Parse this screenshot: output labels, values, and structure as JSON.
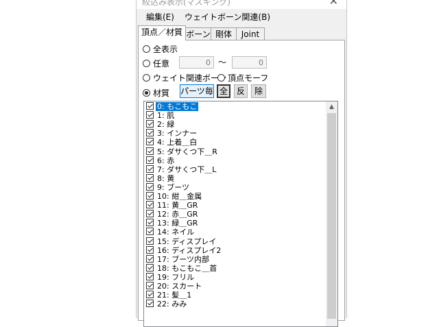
{
  "window": {
    "title": "絞込み表示(マスキング)"
  },
  "menu": {
    "edit": "編集(E)",
    "weight_bone": "ウェイトボーン関連(B)"
  },
  "tabs": {
    "vertex_material": "頂点／材質",
    "bone": "ボーン",
    "rigid": "剛体",
    "joint": "Joint"
  },
  "filters": {
    "all_label": "全表示",
    "any_label": "任意",
    "range_from": "0",
    "tilde": "〜",
    "range_to": "0",
    "weight_bone_label": "ウェイト関連ボーン",
    "vertex_morph_label": "頂点モーフ",
    "material_label": "材質",
    "selected": "material"
  },
  "buttons": {
    "per_part": "パーツ毎",
    "all": "全",
    "invert": "反",
    "remove": "除"
  },
  "materials": [
    {
      "label": "0: もこもこ",
      "checked": true,
      "selected": true
    },
    {
      "label": "1: 肌",
      "checked": true
    },
    {
      "label": "2: 緑",
      "checked": true
    },
    {
      "label": "3: インナー",
      "checked": true
    },
    {
      "label": "4: 上着＿白",
      "checked": true
    },
    {
      "label": "5: ダサくつ下＿R",
      "checked": true
    },
    {
      "label": "6: 赤",
      "checked": true
    },
    {
      "label": "7: ダサくつ下＿L",
      "checked": true
    },
    {
      "label": "8: 黄",
      "checked": true
    },
    {
      "label": "9: ブーツ",
      "checked": true
    },
    {
      "label": "10: 紺＿金属",
      "checked": true
    },
    {
      "label": "11: 黄＿GR",
      "checked": true
    },
    {
      "label": "12: 赤＿GR",
      "checked": true
    },
    {
      "label": "13: 緑＿GR",
      "checked": true
    },
    {
      "label": "14: ネイル",
      "checked": true
    },
    {
      "label": "15: ディスプレイ",
      "checked": true
    },
    {
      "label": "16: ディスプレイ2",
      "checked": true
    },
    {
      "label": "17: ブーツ内部",
      "checked": true
    },
    {
      "label": "18: もこもこ＿首",
      "checked": true
    },
    {
      "label": "19: フリル",
      "checked": true
    },
    {
      "label": "20: スカート",
      "checked": true
    },
    {
      "label": "21: 髪＿1",
      "checked": true
    },
    {
      "label": "22: みみ",
      "checked": true
    }
  ],
  "icons": {
    "close": "close-icon",
    "scroll_up": "chevron-up-icon"
  }
}
